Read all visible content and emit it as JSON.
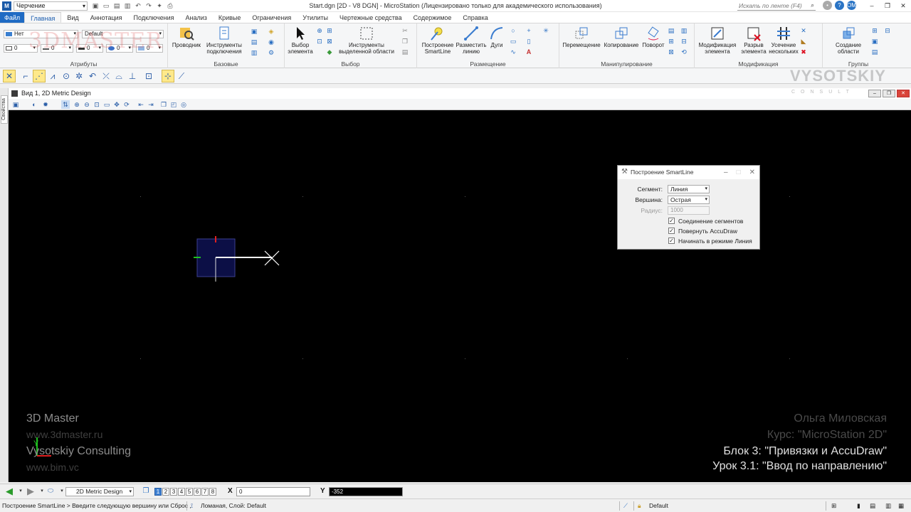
{
  "titlebar": {
    "workspace": "Черчение",
    "window_title": "Start.dgn [2D - V8 DGN] - MicroStation (Лицензировано только для академического использования)",
    "search_placeholder": "Искать по ленте (F4)",
    "user_initials": "OM"
  },
  "ribbon_tabs": [
    "Файл",
    "Главная",
    "Вид",
    "Аннотация",
    "Подключения",
    "Анализ",
    "Кривые",
    "Ограничения",
    "Утилиты",
    "Чертежные средства",
    "Содержимое",
    "Справка"
  ],
  "ribbon": {
    "attributes": {
      "label": "Атрибуты",
      "level": "Нет",
      "style": "Default",
      "color": "0",
      "weight": "0",
      "linestyle": "0",
      "transparency": "0",
      "priority": "0"
    },
    "base": {
      "label": "Базовые",
      "explorer": "Проводник",
      "attach_tools_1": "Инструменты",
      "attach_tools_2": "подключения"
    },
    "select": {
      "label": "Выбор",
      "select_1": "Выбор",
      "select_2": "элемента",
      "tools_1": "Инструменты",
      "tools_2": "выделенной области"
    },
    "placement": {
      "label": "Размещение",
      "smartline_1": "Построение",
      "smartline_2": "SmartLine",
      "placeline_1": "Разместить",
      "placeline_2": "линию",
      "arcs": "Дуги"
    },
    "manipulate": {
      "label": "Манипулирование",
      "move": "Перемещение",
      "copy": "Копирование",
      "rotate": "Поворот"
    },
    "modify": {
      "label": "Модификация",
      "modify_1": "Модификация",
      "modify_2": "элемента",
      "break_1": "Разрыв",
      "break_2": "элемента",
      "trim_1": "Усечение",
      "trim_2": "нескольких"
    },
    "groups": {
      "label": "Группы",
      "create_1": "Создание",
      "create_2": "области"
    }
  },
  "view": {
    "title": "Вид 1, 2D Metric Design",
    "side_tab": "Свойства"
  },
  "dialog": {
    "title": "Построение SmartLine",
    "segment_label": "Сегмент:",
    "segment_value": "Линия",
    "vertex_label": "Вершина:",
    "vertex_value": "Острая",
    "radius_label": "Радиус:",
    "radius_value": "1000",
    "check1": "Соединение сегментов",
    "check2": "Повернуть AccuDraw",
    "check3": "Начинать в режиме Линия"
  },
  "watermarks": {
    "logo_3dmaster": "3DMASTER",
    "logo_vysotskiy": "VYSOTSKIY",
    "logo_consult": "CONSULT",
    "left1": "3D Master",
    "left2": "www.3dmaster.ru",
    "left3": "Vysotskiy Consulting",
    "left4": "www.bim.vc",
    "right1": "Ольга Миловская",
    "right2": "Курс: \"MicroStation 2D\"",
    "right3": "Блок 3: \"Привязки и AccuDraw\"",
    "right4": "Урок 3.1: \"Ввод по направлению\""
  },
  "statusbar": {
    "model": "2D Metric Design",
    "views": [
      "1",
      "2",
      "3",
      "4",
      "5",
      "6",
      "7",
      "8"
    ],
    "x_label": "X",
    "x_value": "0",
    "y_label": "Y",
    "y_value": "-352",
    "prompt": "Построение SmartLine > Введите следующую вершину или Сброс ,",
    "element_info": "Ломаная, Слой: Default",
    "level": "Default"
  },
  "colors": {
    "accent": "#1f6bc4",
    "canvas": "#000000",
    "shape_fill": "#0c0f46",
    "axis_red": "#e02020",
    "axis_green": "#20c020"
  }
}
